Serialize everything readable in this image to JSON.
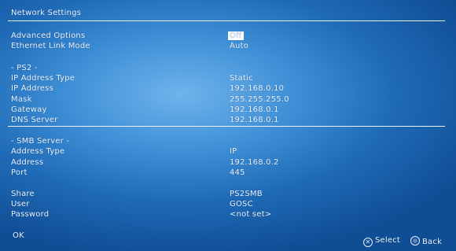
{
  "title": "Network Settings",
  "advanced_options": {
    "label": "Advanced Options",
    "value": "Off"
  },
  "ethernet_link_mode": {
    "label": "Ethernet Link Mode",
    "value": "Auto"
  },
  "ps2": {
    "header": "- PS2 -",
    "ip_address_type": {
      "label": "IP Address Type",
      "value": "Static"
    },
    "ip_address": {
      "label": "IP Address",
      "value": "192.168.0.10"
    },
    "mask": {
      "label": "Mask",
      "value": "255.255.255.0"
    },
    "gateway": {
      "label": "Gateway",
      "value": "192.168.0.1"
    },
    "dns_server": {
      "label": "DNS Server",
      "value": "192.168.0.1"
    }
  },
  "smb": {
    "header": "- SMB Server -",
    "address_type": {
      "label": "Address Type",
      "value": "IP"
    },
    "address": {
      "label": "Address",
      "value": "192.168.0.2"
    },
    "port": {
      "label": "Port",
      "value": "445"
    },
    "share": {
      "label": "Share",
      "value": "PS2SMB"
    },
    "user": {
      "label": "User",
      "value": "GOSC"
    },
    "password": {
      "label": "Password",
      "value": "<not set>"
    }
  },
  "footer": {
    "ok_label": "OK",
    "select_label": "Select",
    "back_label": "Back",
    "select_icon": "cross-button-icon",
    "back_icon": "circle-button-icon"
  }
}
